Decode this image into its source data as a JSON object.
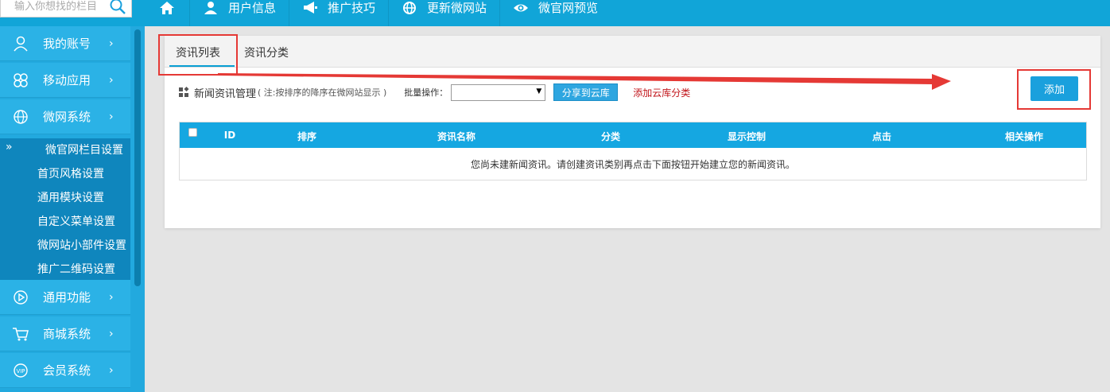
{
  "search": {
    "placeholder": "输入你想找的栏目"
  },
  "topnav": [
    {
      "label": "",
      "icon": "home-icon"
    },
    {
      "label": "用户信息",
      "icon": "user-icon"
    },
    {
      "label": "推广技巧",
      "icon": "megaphone-icon"
    },
    {
      "label": "更新微网站",
      "icon": "globe-icon"
    },
    {
      "label": "微官网预览",
      "icon": "eye-icon"
    }
  ],
  "sidebar": {
    "items": [
      {
        "label": "我的账号",
        "icon": "user-outline-icon",
        "arrow": "›"
      },
      {
        "label": "移动应用",
        "icon": "apps-icon",
        "arrow": "›"
      },
      {
        "label": "微网系统",
        "icon": "globe-outline-icon",
        "arrow": "›"
      },
      {
        "label": "通用功能",
        "icon": "play-circle-icon",
        "arrow": "›"
      },
      {
        "label": "商城系统",
        "icon": "cart-icon",
        "arrow": "›"
      },
      {
        "label": "会员系统",
        "icon": "vip-icon",
        "arrow": "›"
      }
    ],
    "sub_marker": "»",
    "sub_items": [
      "微官网栏目设置",
      "首页风格设置",
      "通用模块设置",
      "自定义菜单设置",
      "微网站小部件设置",
      "推广二维码设置"
    ]
  },
  "tabs": [
    "资讯列表",
    "资讯分类"
  ],
  "toolbar": {
    "title": "新闻资讯管理",
    "note": "( 注:按排序的降序在微网站显示 )",
    "batch_label": "批量操作：",
    "batch_value": "",
    "share_button": "分享到云库",
    "cloud_link": "添加云库分类",
    "add_button": "添加"
  },
  "table": {
    "headers": [
      "ID",
      "排序",
      "资讯名称",
      "分类",
      "显示控制",
      "点击",
      "相关操作"
    ],
    "empty_message": "您尚未建新闻资讯。请创建资讯类别再点击下面按钮开始建立您的新闻资讯。"
  },
  "colors": {
    "topbar": "#11a5d8",
    "sidebar": "#2bb2e6",
    "table_header": "#15a7e1",
    "annotation_red": "#e53935"
  }
}
